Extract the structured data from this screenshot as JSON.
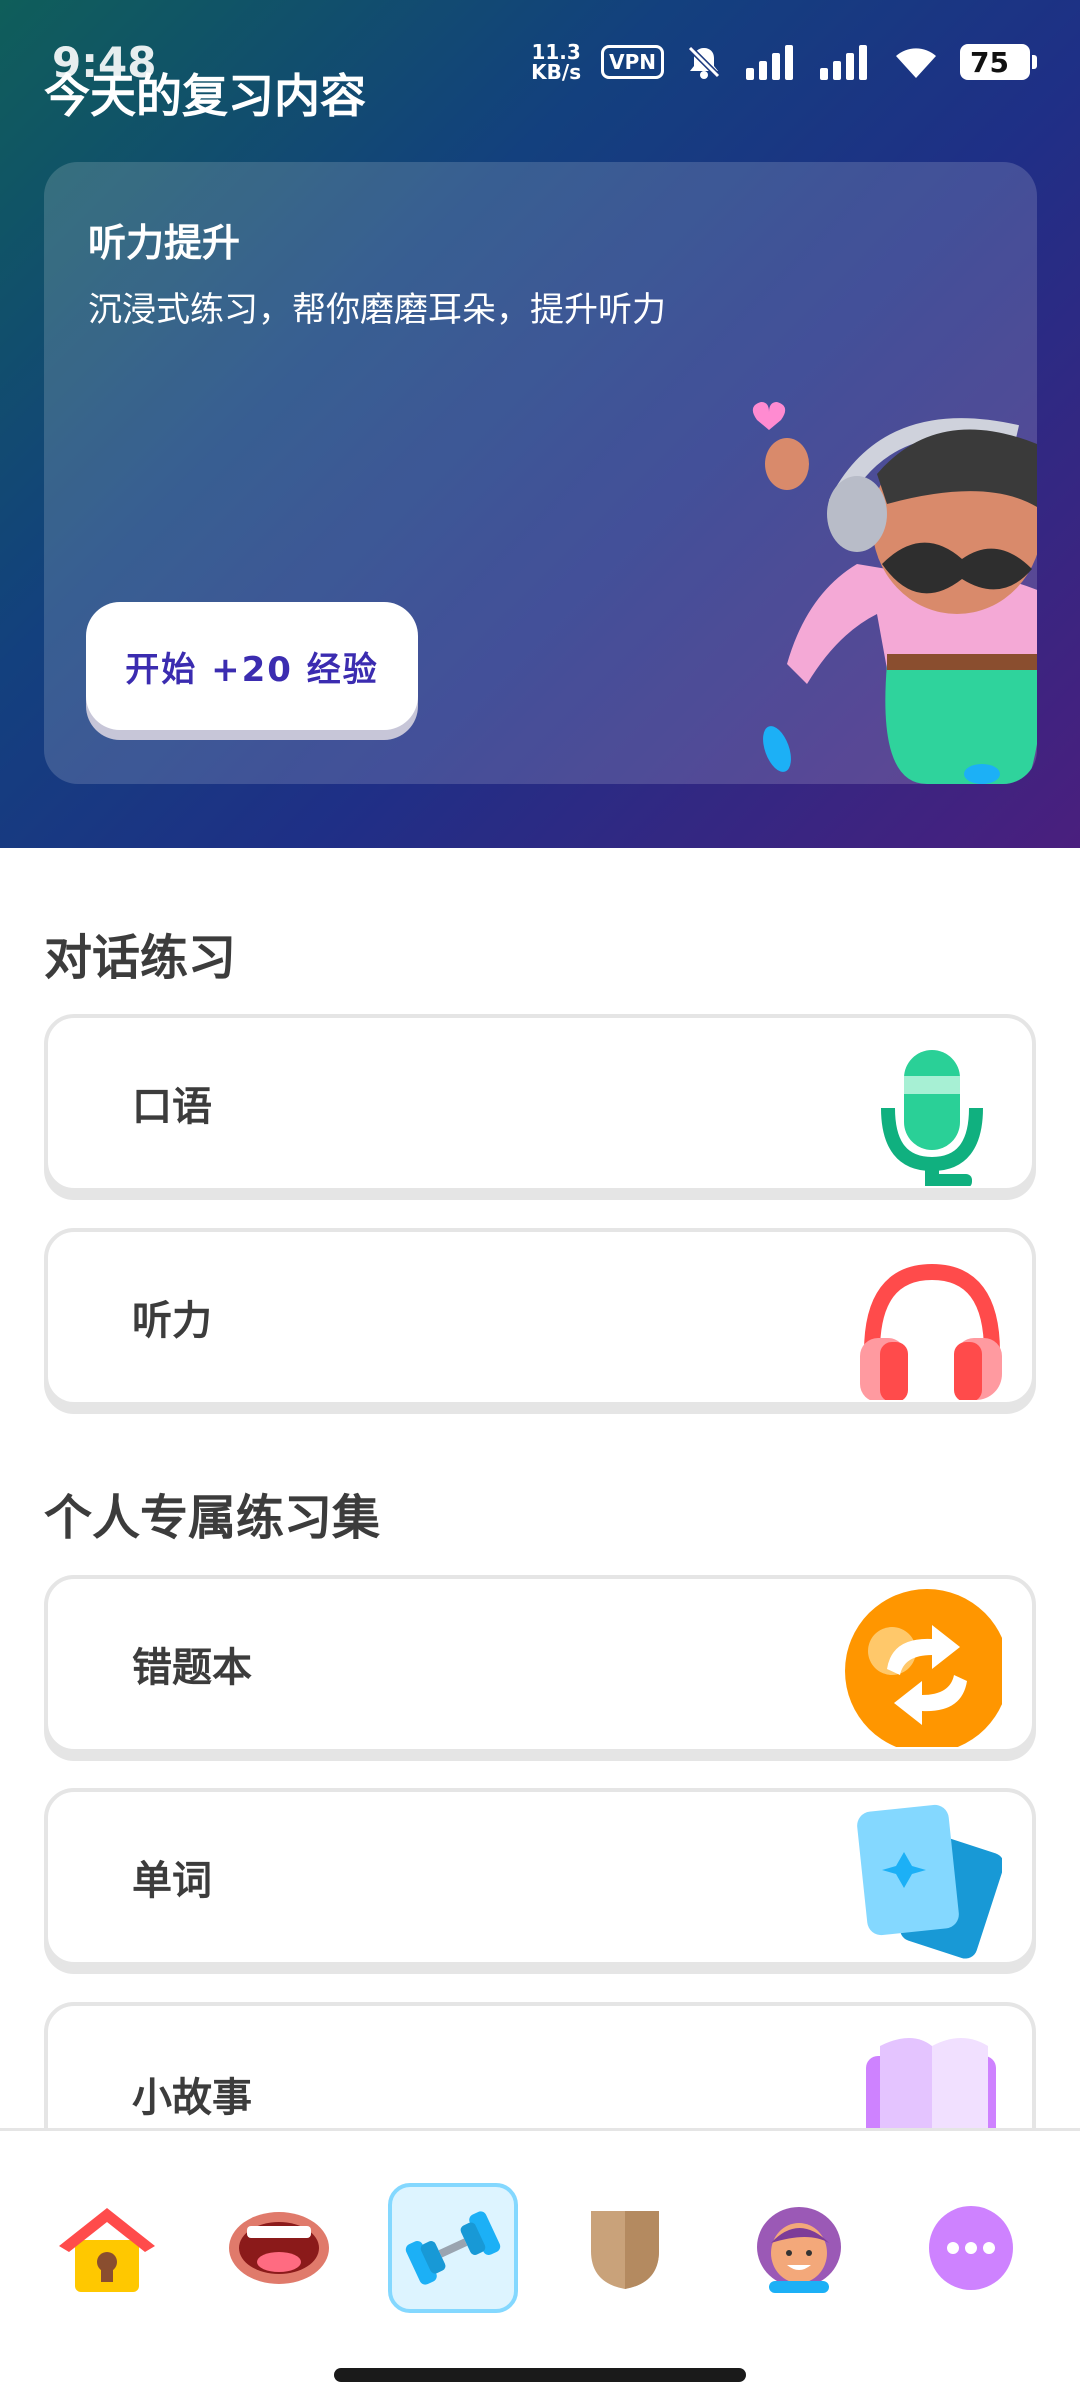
{
  "status_bar": {
    "time": "9:48",
    "net_speed_value": "11.3",
    "net_speed_unit": "KB/s",
    "vpn": "VPN",
    "battery": "75"
  },
  "page_title": "今天的复习内容",
  "promo": {
    "title": "听力提升",
    "description": "沉浸式练习，帮你磨磨耳朵，提升听力",
    "start_button": "开始 +20 经验"
  },
  "sections": {
    "conversation": {
      "title": "对话练习",
      "items": [
        {
          "label": "口语",
          "icon": "microphone-icon"
        },
        {
          "label": "听力",
          "icon": "headphones-icon"
        }
      ]
    },
    "personal": {
      "title": "个人专属练习集",
      "items": [
        {
          "label": "错题本",
          "icon": "refresh-icon"
        },
        {
          "label": "单词",
          "icon": "cards-icon"
        },
        {
          "label": "小故事",
          "icon": "book-icon"
        }
      ]
    }
  },
  "bottom_nav": [
    {
      "name": "home",
      "icon": "house-icon",
      "active": false
    },
    {
      "name": "speak",
      "icon": "mouth-icon",
      "active": false
    },
    {
      "name": "practice",
      "icon": "dumbbell-icon",
      "active": true
    },
    {
      "name": "league",
      "icon": "shield-icon",
      "active": false
    },
    {
      "name": "profile",
      "icon": "avatar-icon",
      "active": false
    },
    {
      "name": "more",
      "icon": "more-icon",
      "active": false
    }
  ],
  "colors": {
    "accent": "#3b2cb0",
    "active_nav_bg": "#ddf4ff",
    "active_nav_border": "#84d8ff",
    "card_border": "#e5e5e5"
  }
}
